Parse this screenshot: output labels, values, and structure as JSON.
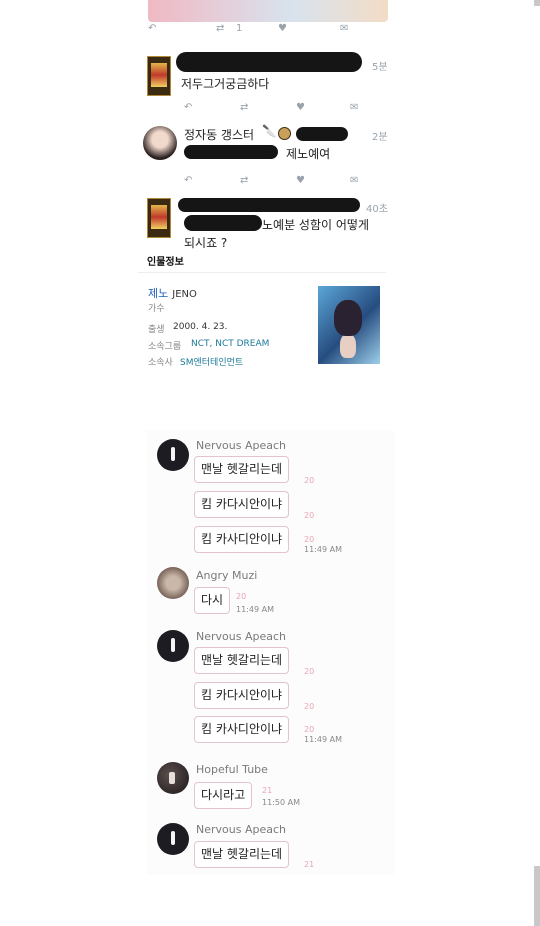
{
  "tweets": {
    "actions": {
      "retweet_count": "1"
    },
    "reply1": {
      "time": "5분",
      "text": "저두그거궁금하다"
    },
    "reply2": {
      "name": "정자동 갱스터",
      "time": "2분",
      "text": "제노예여"
    },
    "reply3": {
      "time": "40초",
      "text_line1": "노예분 성함이 어떻게",
      "text_line2": "되시죠 ?"
    }
  },
  "profile": {
    "heading": "인물정보",
    "name": "제노",
    "name_en": "JENO",
    "job": "가수",
    "birth_label": "출생",
    "birth_value": "2000. 4. 23.",
    "group_label": "소속그룹",
    "group_value": "NCT, NCT DREAM",
    "agency_label": "소속사",
    "agency_value": "SM엔터테인먼트"
  },
  "chat": [
    {
      "name": "Nervous Apeach",
      "bubbles": [
        {
          "text": "맨날 헷갈리는데",
          "count": "20"
        },
        {
          "text": "킴 카다시안이냐",
          "count": "20"
        },
        {
          "text": "킴 카사디안이냐",
          "count": "20",
          "time": "11:49 AM"
        }
      ]
    },
    {
      "name": "Angry Muzi",
      "bubbles": [
        {
          "text": "다시",
          "count": "20",
          "time": "11:49 AM"
        }
      ]
    },
    {
      "name": "Nervous Apeach",
      "bubbles": [
        {
          "text": "맨날 헷갈리는데",
          "count": "20"
        },
        {
          "text": "킴 카다시안이냐",
          "count": "20"
        },
        {
          "text": "킴 카사디안이냐",
          "count": "20",
          "time": "11:49 AM"
        }
      ]
    },
    {
      "name": "Hopeful Tube",
      "bubbles": [
        {
          "text": "다시라고",
          "count": "21",
          "time": "11:50 AM"
        }
      ]
    },
    {
      "name": "Nervous Apeach",
      "bubbles": [
        {
          "text": "맨날 헷갈리는데",
          "count": "21"
        }
      ]
    }
  ],
  "icons": {
    "reply": "reply-icon",
    "retweet": "retweet-icon",
    "like": "heart-icon",
    "message": "dm-icon"
  }
}
